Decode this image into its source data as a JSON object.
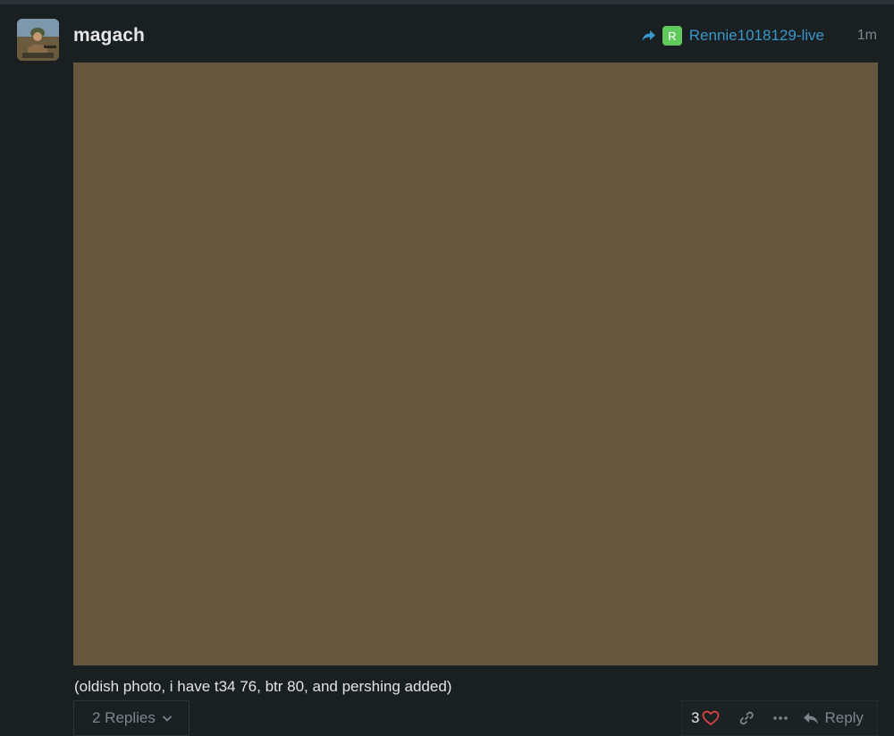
{
  "post": {
    "username": "magach",
    "reply_to": {
      "avatar_letter": "R",
      "username": "Rennie1018129-live"
    },
    "date": "1m",
    "text": "(oldish photo, i have t34 76, btr 80, and pershing added)",
    "replies_label": "2 Replies",
    "like_count": "3",
    "reply_label": "Reply"
  },
  "colors": {
    "background": "#1a1f22",
    "link_blue": "#3a98c9",
    "muted": "#7e878c",
    "heart": "#e04646",
    "reply_avatar": "#5fc95b",
    "image_placeholder": "#66583e"
  },
  "icons": [
    "reply-arrow-icon",
    "chevron-down-icon",
    "heart-icon",
    "link-icon",
    "more-icon",
    "reply-icon"
  ]
}
